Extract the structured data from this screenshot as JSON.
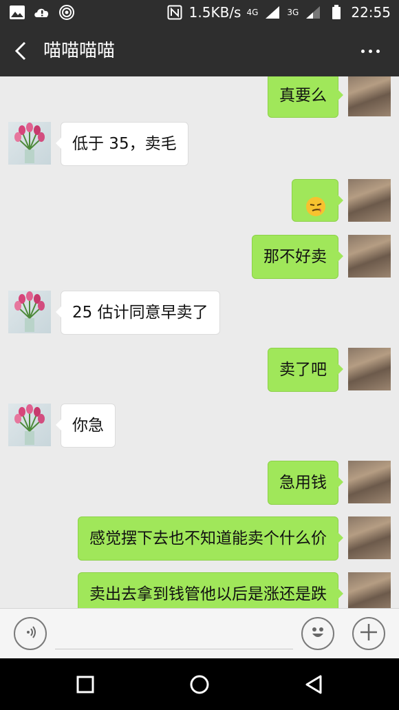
{
  "status_bar": {
    "speed": "1.5KB/s",
    "net1": "4G",
    "net2": "3G",
    "time": "22:55"
  },
  "header": {
    "title": "喵喵喵喵"
  },
  "messages": [
    {
      "side": "out",
      "text": "真要么"
    },
    {
      "side": "in",
      "text": "低于 35，卖毛"
    },
    {
      "side": "out",
      "text": "",
      "emoji": "smirk"
    },
    {
      "side": "out",
      "text": "那不好卖"
    },
    {
      "side": "in",
      "text": "25 估计同意早卖了"
    },
    {
      "side": "out",
      "text": "卖了吧"
    },
    {
      "side": "in",
      "text": "你急"
    },
    {
      "side": "out",
      "text": "急用钱"
    },
    {
      "side": "out",
      "text": "感觉摆下去也不知道能卖个什么价"
    },
    {
      "side": "out",
      "text": "卖出去拿到钱管他以后是涨还是跌"
    }
  ],
  "colors": {
    "bar": "#2e2e2e",
    "chat_bg": "#ebebeb",
    "bubble_out": "#a0e75a",
    "bubble_in": "#ffffff"
  }
}
